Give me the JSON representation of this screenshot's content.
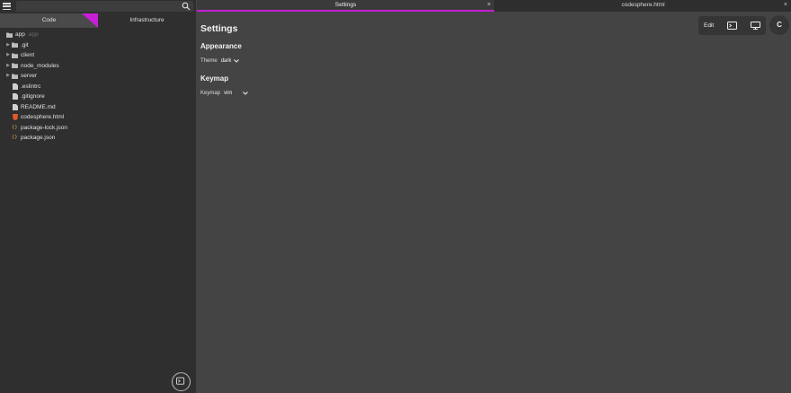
{
  "sidebar": {
    "tabs": [
      {
        "label": "Code"
      },
      {
        "label": "Infrastructure"
      }
    ],
    "tree": [
      {
        "label": "app",
        "type": "root",
        "extra": "app"
      },
      {
        "label": ".git",
        "type": "folder"
      },
      {
        "label": "client",
        "type": "folder"
      },
      {
        "label": "node_modules",
        "type": "folder"
      },
      {
        "label": "server",
        "type": "folder"
      },
      {
        "label": ".eslintrc",
        "type": "file"
      },
      {
        "label": ".gitignore",
        "type": "file"
      },
      {
        "label": "README.md",
        "type": "file"
      },
      {
        "label": "codesphere.html",
        "type": "html"
      },
      {
        "label": "package-lock.json",
        "type": "json"
      },
      {
        "label": "package.json",
        "type": "json"
      }
    ]
  },
  "editor_tabs": [
    {
      "label": "Settings",
      "close": "×"
    },
    {
      "label": "codesphere.html",
      "close": "×"
    }
  ],
  "settings": {
    "title": "Settings",
    "appearance": {
      "heading": "Appearance",
      "theme_label": "Theme",
      "theme_value": "dark"
    },
    "keymap": {
      "heading": "Keymap",
      "keymap_label": "Keymap",
      "keymap_value": "vim"
    }
  },
  "toolbar": {
    "edit_label": "Edit",
    "refresh_label": "C"
  },
  "colors": {
    "accent": "#c61fd6",
    "sidebar_bg": "#2f2f2f",
    "main_bg": "#444444"
  }
}
